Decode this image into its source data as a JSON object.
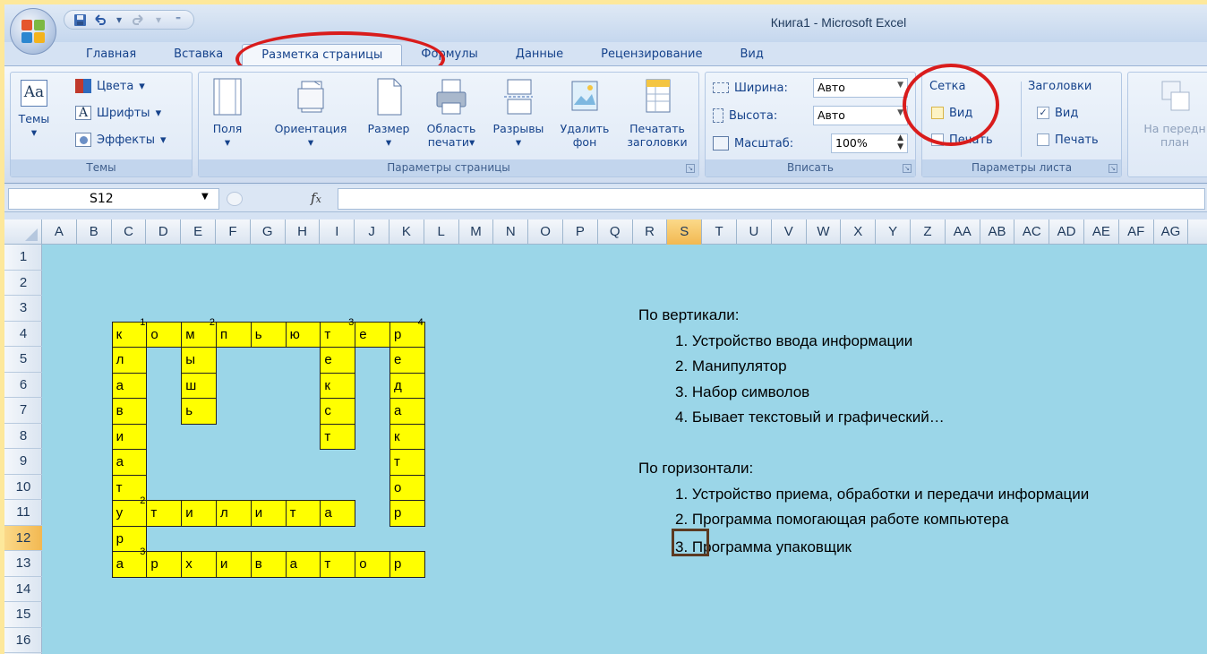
{
  "window": {
    "title": "Книга1 - Microsoft Excel"
  },
  "qat": {
    "icons": [
      "save-icon",
      "undo-icon",
      "redo-icon",
      "customize-icon"
    ]
  },
  "tabs": [
    {
      "label": "Главная"
    },
    {
      "label": "Вставка"
    },
    {
      "label": "Разметка страницы",
      "active": true
    },
    {
      "label": "Формулы"
    },
    {
      "label": "Данные"
    },
    {
      "label": "Рецензирование"
    },
    {
      "label": "Вид"
    }
  ],
  "ribbon": {
    "themes": {
      "themes_label": "Темы",
      "colors_label": "Цвета",
      "fonts_label": "Шрифты",
      "effects_label": "Эффекты",
      "group_label": "Темы"
    },
    "page_setup": {
      "margins": "Поля",
      "orientation": "Ориентация",
      "size": "Размер",
      "print_area_1": "Область",
      "print_area_2": "печати",
      "breaks": "Разрывы",
      "background_1": "Удалить",
      "background_2": "фон",
      "print_titles_1": "Печатать",
      "print_titles_2": "заголовки",
      "group_label": "Параметры страницы"
    },
    "scale": {
      "width_label": "Ширина:",
      "width_value": "Авто",
      "height_label": "Высота:",
      "height_value": "Авто",
      "scale_label": "Масштаб:",
      "scale_value": "100%",
      "group_label": "Вписать"
    },
    "sheet_options": {
      "gridlines": "Сетка",
      "headings": "Заголовки",
      "view": "Вид",
      "print": "Печать",
      "gridlines_view_checked": false,
      "headings_view_checked": true,
      "group_label": "Параметры листа"
    },
    "arrange": {
      "bring_forward_1": "На передн",
      "bring_forward_2": "план"
    }
  },
  "formula_bar": {
    "name_box": "S12",
    "fx": "fx",
    "value": ""
  },
  "columns": [
    "A",
    "B",
    "C",
    "D",
    "E",
    "F",
    "G",
    "H",
    "I",
    "J",
    "K",
    "L",
    "M",
    "N",
    "O",
    "P",
    "Q",
    "R",
    "S",
    "T",
    "U",
    "V",
    "W",
    "X",
    "Y",
    "Z",
    "AA",
    "AB",
    "AC",
    "AD",
    "AE",
    "AF",
    "AG"
  ],
  "selected_column": "S",
  "rows": [
    "1",
    "2",
    "3",
    "4",
    "5",
    "6",
    "7",
    "8",
    "9",
    "10",
    "11",
    "12",
    "13",
    "14",
    "15",
    "16"
  ],
  "selected_row": "12",
  "crossword": {
    "cells": [
      {
        "col": "C",
        "row": 4,
        "text": "к",
        "num": "1"
      },
      {
        "col": "D",
        "row": 4,
        "text": "о"
      },
      {
        "col": "E",
        "row": 4,
        "text": "м",
        "num": "2"
      },
      {
        "col": "F",
        "row": 4,
        "text": "п"
      },
      {
        "col": "G",
        "row": 4,
        "text": "ь"
      },
      {
        "col": "H",
        "row": 4,
        "text": "ю"
      },
      {
        "col": "I",
        "row": 4,
        "text": "т",
        "num": "3"
      },
      {
        "col": "J",
        "row": 4,
        "text": "е"
      },
      {
        "col": "K",
        "row": 4,
        "text": "р",
        "num": "4"
      },
      {
        "col": "C",
        "row": 5,
        "text": "л"
      },
      {
        "col": "C",
        "row": 6,
        "text": "а"
      },
      {
        "col": "C",
        "row": 7,
        "text": "в"
      },
      {
        "col": "C",
        "row": 8,
        "text": "и"
      },
      {
        "col": "C",
        "row": 9,
        "text": "а"
      },
      {
        "col": "C",
        "row": 10,
        "text": "т"
      },
      {
        "col": "C",
        "row": 11,
        "text": "у",
        "num": "2"
      },
      {
        "col": "C",
        "row": 12,
        "text": "р"
      },
      {
        "col": "C",
        "row": 13,
        "text": "а",
        "num": "3"
      },
      {
        "col": "E",
        "row": 5,
        "text": "ы"
      },
      {
        "col": "E",
        "row": 6,
        "text": "ш"
      },
      {
        "col": "E",
        "row": 7,
        "text": "ь"
      },
      {
        "col": "I",
        "row": 5,
        "text": "е"
      },
      {
        "col": "I",
        "row": 6,
        "text": "к"
      },
      {
        "col": "I",
        "row": 7,
        "text": "с"
      },
      {
        "col": "I",
        "row": 8,
        "text": "т"
      },
      {
        "col": "K",
        "row": 5,
        "text": "е"
      },
      {
        "col": "K",
        "row": 6,
        "text": "д"
      },
      {
        "col": "K",
        "row": 7,
        "text": "а"
      },
      {
        "col": "K",
        "row": 8,
        "text": "к"
      },
      {
        "col": "K",
        "row": 9,
        "text": "т"
      },
      {
        "col": "K",
        "row": 10,
        "text": "о"
      },
      {
        "col": "K",
        "row": 11,
        "text": "р"
      },
      {
        "col": "D",
        "row": 11,
        "text": "т"
      },
      {
        "col": "E",
        "row": 11,
        "text": "и"
      },
      {
        "col": "F",
        "row": 11,
        "text": "л"
      },
      {
        "col": "G",
        "row": 11,
        "text": "и"
      },
      {
        "col": "H",
        "row": 11,
        "text": "т"
      },
      {
        "col": "I",
        "row": 11,
        "text": "а"
      },
      {
        "col": "D",
        "row": 13,
        "text": "р"
      },
      {
        "col": "E",
        "row": 13,
        "text": "х"
      },
      {
        "col": "F",
        "row": 13,
        "text": "и"
      },
      {
        "col": "G",
        "row": 13,
        "text": "в"
      },
      {
        "col": "H",
        "row": 13,
        "text": "а"
      },
      {
        "col": "I",
        "row": 13,
        "text": "т"
      },
      {
        "col": "J",
        "row": 13,
        "text": "о"
      },
      {
        "col": "K",
        "row": 13,
        "text": "р"
      }
    ]
  },
  "clues": {
    "vertical_title": "По вертикали:",
    "vertical": [
      "1. Устройство ввода информации",
      "2. Манипулятор",
      "3. Набор символов",
      "4. Бывает текстовый и графический…"
    ],
    "horizontal_title": "По горизонтали:",
    "horizontal": [
      "1. Устройство приема, обработки и передачи информации",
      "2. Программа помогающая работе компьютера",
      "3. Программа упаковщик"
    ]
  },
  "colors": {
    "accent_red": "#d91c1c",
    "cell_yellow": "#ffff00",
    "sheet_background": "#9bd6e8",
    "selection_orange": "#f2b851"
  }
}
